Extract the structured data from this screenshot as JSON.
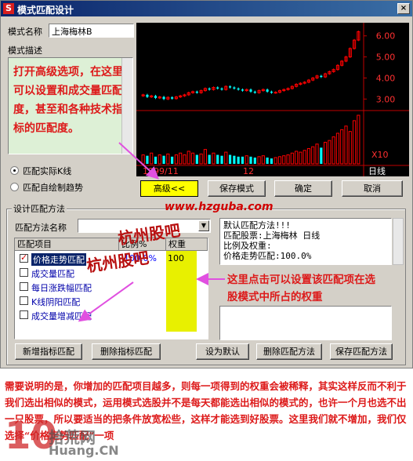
{
  "window": {
    "app_icon": "S",
    "title": "模式匹配设计",
    "close_label": "×"
  },
  "pattern": {
    "name_label": "模式名称",
    "name_value": "上海梅林B",
    "desc_label": "模式描述",
    "desc_text": "打开高级选项，在这里可以设置和成交量匹配度，甚至和各种技术指标的匹配度。"
  },
  "match_mode": {
    "options": [
      {
        "label": "匹配实际K线",
        "selected": true
      },
      {
        "label": "匹配自绘制趋势",
        "selected": false
      }
    ]
  },
  "chart_data": {
    "type": "candlestick",
    "y_ticks": [
      "6.00",
      "5.00",
      "4.00",
      "3.00"
    ],
    "x_labels": [
      "1999/11",
      "12"
    ],
    "volume_label": "X10",
    "period_label": "日线",
    "up_color": "#ff0000",
    "down_color": "#00ffff",
    "closes": [
      3.2,
      3.1,
      3.15,
      3.05,
      3.1,
      3.0,
      3.08,
      3.02,
      3.1,
      3.15,
      3.2,
      3.3,
      3.35,
      3.3,
      3.4,
      3.5,
      3.45,
      3.55,
      3.5,
      3.45,
      3.6,
      3.55,
      3.5,
      3.45,
      3.4,
      3.45,
      3.35,
      3.3,
      3.4,
      3.45,
      3.35,
      3.3,
      3.32,
      3.4,
      3.45,
      3.5,
      3.6,
      3.7,
      3.75,
      3.8,
      3.9,
      4.0,
      4.1,
      4.05,
      4.2,
      4.3,
      4.4,
      4.6,
      4.8,
      5.0,
      5.4,
      5.8,
      6.2
    ],
    "volumes": [
      1.0,
      0.9,
      1.2,
      0.8,
      1.0,
      0.9,
      1.1,
      0.8,
      1.0,
      1.2,
      1.0,
      1.4,
      1.2,
      1.0,
      1.1,
      1.6,
      1.0,
      1.2,
      1.0,
      0.9,
      1.3,
      1.0,
      0.9,
      0.8,
      0.8,
      0.9,
      0.8,
      0.7,
      0.8,
      0.9,
      0.7,
      0.6,
      0.7,
      0.8,
      0.9,
      1.0,
      1.2,
      1.4,
      1.3,
      1.5,
      1.7,
      1.9,
      2.2,
      1.8,
      2.4,
      2.6,
      3.0,
      3.4,
      3.8,
      4.2,
      3.6,
      4.8,
      5.4
    ]
  },
  "buttons": {
    "advanced": "高级<<",
    "save_pattern": "保存模式",
    "ok": "确定",
    "cancel": "取消",
    "add_indicator": "新增指标匹配",
    "delete_indicator": "删除指标匹配",
    "set_default": "设为默认",
    "delete_method": "删除匹配方法",
    "save_method": "保存匹配方法"
  },
  "design": {
    "group_label": "设计匹配方法",
    "method_name_label": "匹配方法名称",
    "info_title": "默认匹配方法!!!",
    "info_lines": [
      "匹配股票:上海梅林  日线",
      "比例及权重:",
      "价格走势匹配:100.0%"
    ]
  },
  "list": {
    "col_item": "匹配项目",
    "col_ratio": "比例%",
    "col_weight": "权重",
    "rows": [
      {
        "label": "价格走势匹配",
        "checked": true,
        "ratio": "100.0%",
        "weight": "100",
        "selected": true
      },
      {
        "label": "成交量匹配",
        "checked": false,
        "ratio": "",
        "weight": ""
      },
      {
        "label": "每日涨跌幅匹配",
        "checked": false,
        "ratio": "",
        "weight": ""
      },
      {
        "label": "K线阴阳匹配",
        "checked": false,
        "ratio": "",
        "weight": ""
      },
      {
        "label": "成交量增减匹配",
        "checked": false,
        "ratio": "",
        "weight": ""
      }
    ]
  },
  "annotations": {
    "right_note": "这里点击可以设置该匹配项在选股模式中所占的权重",
    "bottom_note": "需要说明的是，你增加的匹配项目越多，则每一项得到的权重会被稀释，其实这样反而不利于我们选出相似的模式，运用模式选股并不是每天都能选出相似的模式的，也许一个月也选不出一只股票，所以要适当的把条件放宽松些，这样才能选到好股票。这里我们就不增加，我们仅选择“价格走势匹配”一项"
  },
  "watermarks": {
    "site": "www.hzguba.com",
    "site_cn": "杭州股吧",
    "logo_cn": "拾荒网",
    "logo_num": "10",
    "logo_en": "Huang.CN"
  }
}
